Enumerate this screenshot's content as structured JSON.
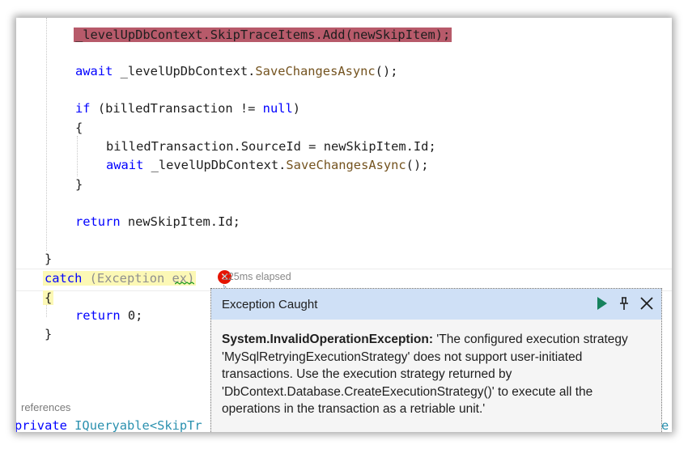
{
  "editor": {
    "lines": {
      "l1": "_levelUpDbContext.SkipTraceItems.Add(newSkipItem);",
      "l2_kw": "await",
      "l2_a": " _levelUpDbContext.",
      "l2_m": "SaveChangesAsync",
      "l2_b": "();",
      "l3_kw": "if",
      "l3_a": " (billedTransaction != ",
      "l3_kw2": "null",
      "l3_b": ")",
      "l4": "{",
      "l5_a": "billedTransaction.SourceId = ",
      "l5_b": "newSkipItem.Id;",
      "l6_kw": "await",
      "l6_a": " _levelUpDbContext.",
      "l6_m": "SaveChangesAsync",
      "l6_b": "();",
      "l7": "}",
      "l8_kw": "return",
      "l8_a": " newSkipItem.Id;",
      "l9": "}",
      "l10_kw": "catch",
      "l10_a": " (Exception ex)",
      "l11": "{",
      "l12_kw": "return",
      "l12_a": " 0;",
      "l13": "}"
    },
    "elapsed": "≤25ms elapsed",
    "references_label": "references",
    "bottom_code": {
      "kw": "private",
      "type": "IQueryable",
      "rest": "<SkipTr",
      "right_peek": "e"
    }
  },
  "popup": {
    "title": "Exception Caught",
    "exception_type": "System.InvalidOperationException:",
    "message": " 'The configured execution strategy 'MySqlRetryingExecutionStrategy' does not support user-initiated transactions. Use the execution strategy returned by 'DbContext.Database.CreateExecutionStrategy()' to execute all the operations in the transaction as a retriable unit.'",
    "buttons": {
      "continue": "play-icon",
      "pin": "pin-icon",
      "close": "close-icon"
    }
  },
  "colors": {
    "keyword": "#0000ff",
    "method": "#74531f",
    "type": "#2b91af",
    "current_statement_highlight": "#b75a6a",
    "exception_line_highlight": "#fcf8b5",
    "popup_header": "#cfe0f6",
    "error_icon": "#e51400",
    "continue_green": "#16825d"
  }
}
